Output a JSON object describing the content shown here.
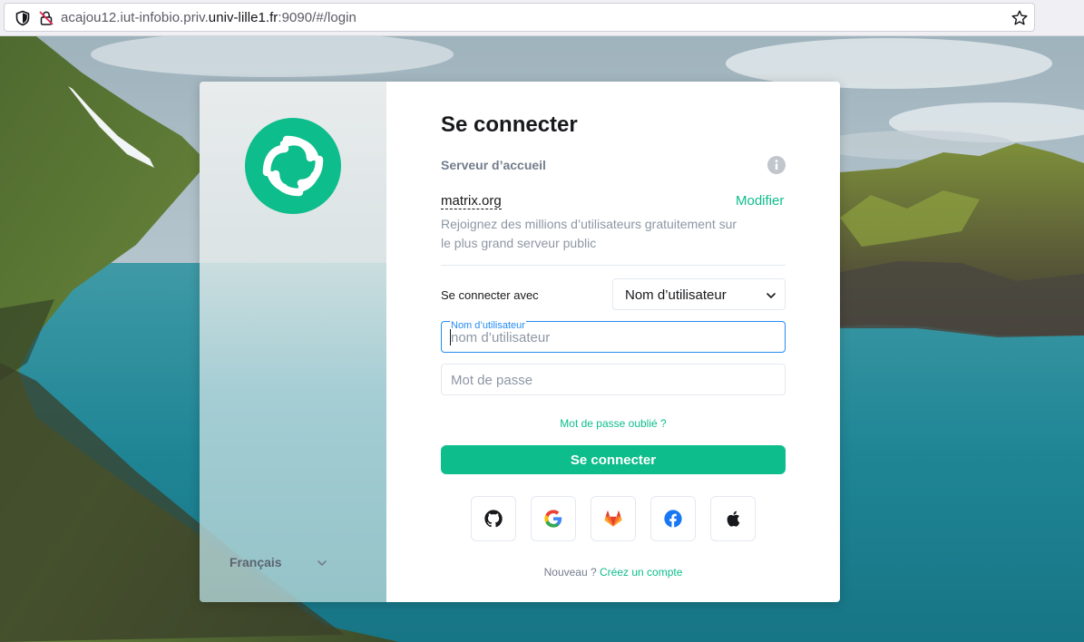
{
  "browser": {
    "url_prefix": "acajou12.iut-infobio.priv.",
    "url_domain": "univ-lille1.fr",
    "url_suffix": ":9090/#/login"
  },
  "sidebar": {
    "language": "Français"
  },
  "login": {
    "title": "Se connecter",
    "homeserver_label": "Serveur d’accueil",
    "homeserver_name": "matrix.org",
    "homeserver_edit": "Modifier",
    "homeserver_description": "Rejoignez des millions d’utilisateurs gratuitement sur le plus grand serveur public",
    "login_with_label": "Se connecter avec",
    "login_with_value": "Nom d’utilisateur",
    "username_label": "Nom d’utilisateur",
    "username_placeholder": "nom d’utilisateur",
    "username_value": "",
    "password_placeholder": "Mot de passe",
    "password_value": "",
    "forgot_password": "Mot de passe oublié ?",
    "submit": "Se connecter",
    "sso_providers": [
      "github-icon",
      "google-icon",
      "gitlab-icon",
      "facebook-icon",
      "apple-icon"
    ],
    "signup_prompt": "Nouveau ?",
    "signup_link": "Créez un compte"
  },
  "colors": {
    "accent": "#0dbd8b",
    "focus": "#238cf5",
    "text": "#17191c",
    "muted": "#737d8c"
  }
}
